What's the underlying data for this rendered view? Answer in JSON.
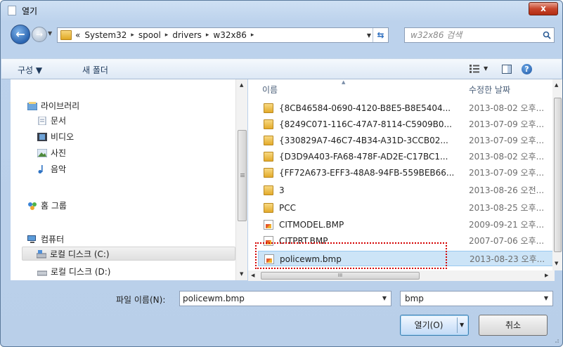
{
  "window": {
    "title": "열기",
    "close_label": "x"
  },
  "address": {
    "overflow": "«",
    "crumbs": [
      "System32",
      "spool",
      "drivers",
      "w32x86"
    ],
    "separator": "▸"
  },
  "search": {
    "placeholder": "w32x86 검색"
  },
  "toolbar": {
    "organize": "구성 ▼",
    "new_folder": "새 폴더",
    "help": "?"
  },
  "nav": {
    "library": "라이브러리",
    "documents": "문서",
    "videos": "비디오",
    "pictures": "사진",
    "music": "음악",
    "homegroup": "홈 그룹",
    "computer": "컴퓨터",
    "drive_c": "로컬 디스크 (C:)",
    "drive_d": "로컬 디스크 (D:)"
  },
  "columns": {
    "name": "이름",
    "date": "수정한 날짜"
  },
  "files": [
    {
      "name": "{8CB46584-0690-4120-B8E5-B8E5404...",
      "date": "2013-08-02 오후...",
      "type": "folder"
    },
    {
      "name": "{8249C071-116C-47A7-8114-C5909B0...",
      "date": "2013-07-09 오후...",
      "type": "folder"
    },
    {
      "name": "{330829A7-46C7-4B34-A31D-3CCB02...",
      "date": "2013-07-09 오후...",
      "type": "folder"
    },
    {
      "name": "{D3D9A403-FA68-478F-AD2E-C17BC1...",
      "date": "2013-08-02 오후...",
      "type": "folder"
    },
    {
      "name": "{FF72A673-EFF3-48A8-94FB-559BEB66...",
      "date": "2013-07-09 오후...",
      "type": "folder"
    },
    {
      "name": "3",
      "date": "2013-08-26 오전...",
      "type": "folder"
    },
    {
      "name": "PCC",
      "date": "2013-08-25 오후...",
      "type": "folder"
    },
    {
      "name": "CITMODEL.BMP",
      "date": "2009-09-21 오후...",
      "type": "bmp"
    },
    {
      "name": "CITPRT.BMP",
      "date": "2007-07-06 오후...",
      "type": "bmp"
    },
    {
      "name": "policewm.bmp",
      "date": "2013-08-23 오후...",
      "type": "bmp",
      "selected": true
    }
  ],
  "bottom": {
    "filename_label": "파일 이름(N):",
    "filename_value": "policewm.bmp",
    "filetype_value": "bmp",
    "open_label": "열기(O)",
    "cancel_label": "취소"
  },
  "colors": {
    "selection": "#cce4f7",
    "highlight_box": "#d40000"
  }
}
